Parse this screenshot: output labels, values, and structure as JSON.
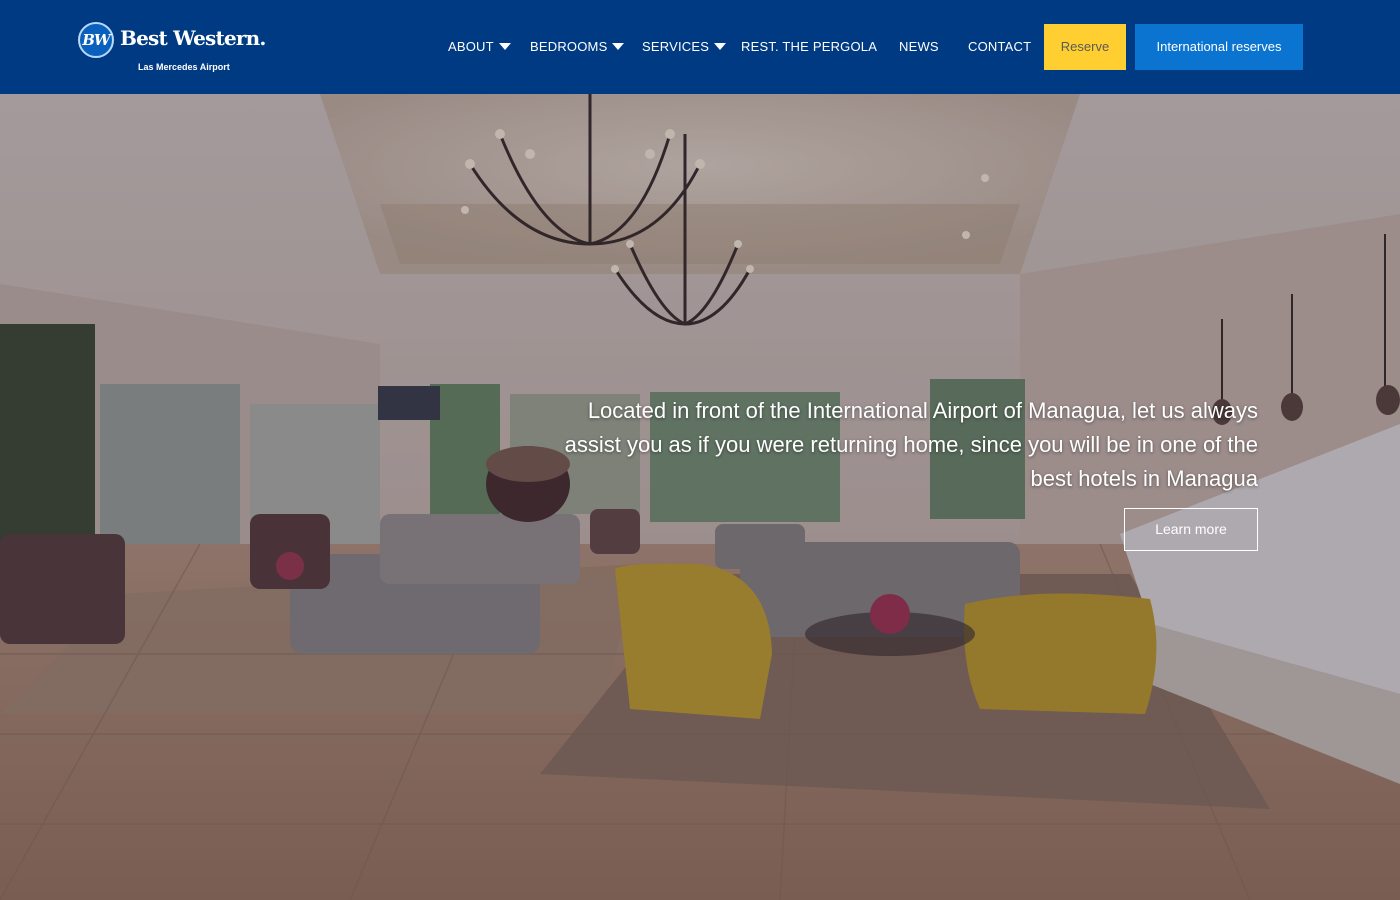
{
  "brand": {
    "badge": "BW",
    "name": "Best Western.",
    "location": "Las Mercedes Airport"
  },
  "nav": {
    "items": [
      {
        "label": "ABOUT",
        "dropdown": true
      },
      {
        "label": "BEDROOMS",
        "dropdown": true
      },
      {
        "label": "SERVICES",
        "dropdown": true
      },
      {
        "label": "REST. THE PERGOLA",
        "dropdown": false
      },
      {
        "label": "NEWS",
        "dropdown": false
      },
      {
        "label": "CONTACT",
        "dropdown": false
      }
    ],
    "reserve_label": "Reserve",
    "international_label": "International reserves"
  },
  "hero": {
    "tagline": "Located in front of the International Airport of Managua, let us always assist you as if you were returning home, since you will be in one of the best hotels in Managua",
    "cta_label": "Learn more"
  },
  "colors": {
    "header_bg": "#003a82",
    "reserve_bg": "#ffcf31",
    "international_bg": "#0b74d1"
  }
}
